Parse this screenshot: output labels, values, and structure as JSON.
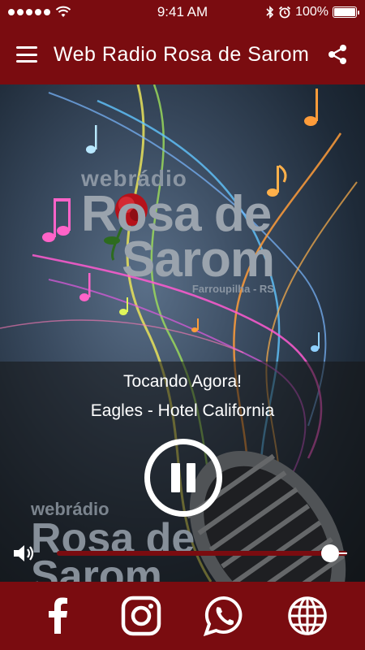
{
  "status_bar": {
    "time": "9:41 AM",
    "battery": "100%",
    "icons": [
      "signal-dots-icon",
      "wifi-icon",
      "bluetooth-icon",
      "alarm-icon",
      "battery-icon"
    ]
  },
  "header": {
    "menu_icon": "hamburger-menu-icon",
    "title": "Web Radio Rosa de Sarom",
    "share_icon": "share-icon"
  },
  "artwork": {
    "logo_top": "webrádio",
    "logo_line1": "Rosa de",
    "logo_line2": "Sarom",
    "logo_location": "Farroupilha - RS",
    "logo_bottom_top": "webrádio",
    "logo_bottom_line1": "Rosa de",
    "logo_bottom_line2": "Sarom"
  },
  "player": {
    "now_playing_label": "Tocando Agora!",
    "track": "Eagles - Hotel California",
    "state": "playing",
    "pause_icon": "pause-icon",
    "volume_icon": "speaker-icon",
    "volume_level": 0.94
  },
  "footer": {
    "links": [
      {
        "icon": "facebook-icon"
      },
      {
        "icon": "instagram-icon"
      },
      {
        "icon": "whatsapp-icon"
      },
      {
        "icon": "globe-icon"
      }
    ]
  },
  "colors": {
    "brand": "#7a0c10",
    "accent_white": "#ffffff"
  }
}
